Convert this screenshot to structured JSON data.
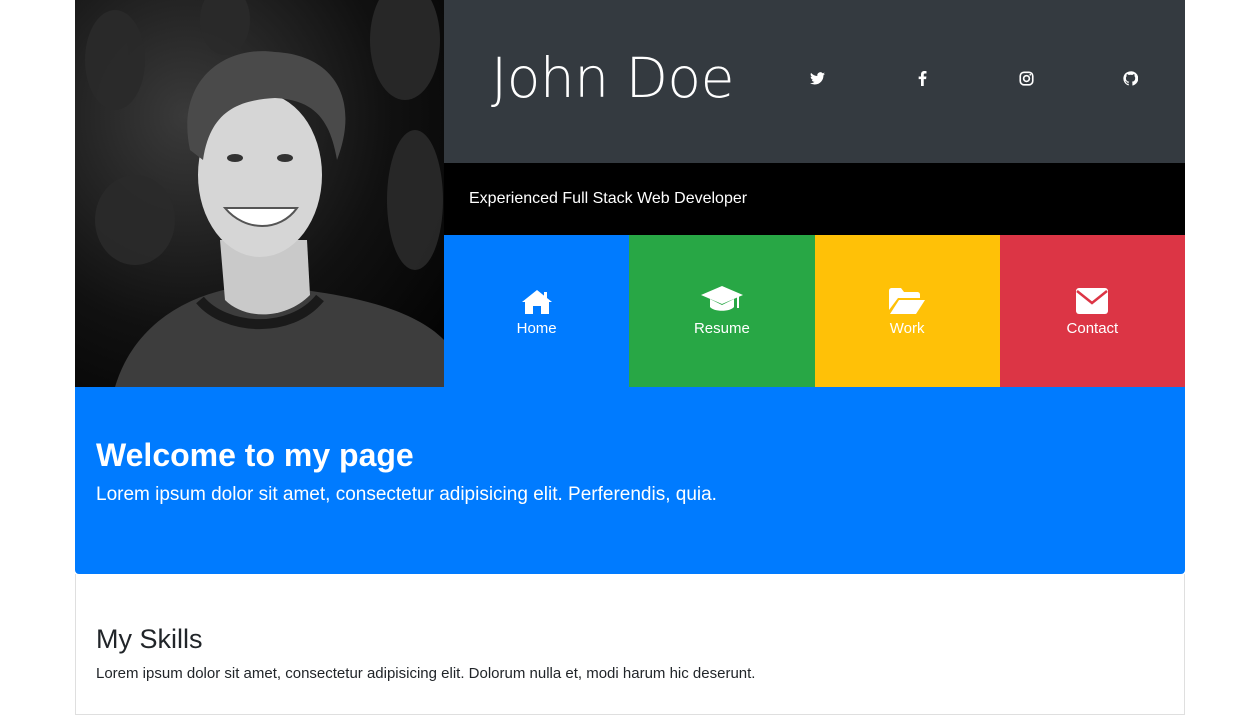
{
  "profile": {
    "name": "John Doe",
    "tagline": "Experienced Full Stack Web Developer"
  },
  "social": [
    {
      "icon": "twitter-icon"
    },
    {
      "icon": "facebook-icon"
    },
    {
      "icon": "instagram-icon"
    },
    {
      "icon": "github-icon"
    }
  ],
  "nav": [
    {
      "label": "Home",
      "icon": "home-icon",
      "color": "#007bff"
    },
    {
      "label": "Resume",
      "icon": "graduation-cap-icon",
      "color": "#28a745"
    },
    {
      "label": "Work",
      "icon": "folder-open-icon",
      "color": "#ffc107"
    },
    {
      "label": "Contact",
      "icon": "envelope-icon",
      "color": "#dc3545"
    }
  ],
  "welcome": {
    "title": "Welcome to my page",
    "text": "Lorem ipsum dolor sit amet, consectetur adipisicing elit. Perferendis, quia.",
    "color": "#007bff"
  },
  "skills": {
    "title": "My Skills",
    "text": "Lorem ipsum dolor sit amet, consectetur adipisicing elit. Dolorum nulla et, modi harum hic deserunt."
  }
}
